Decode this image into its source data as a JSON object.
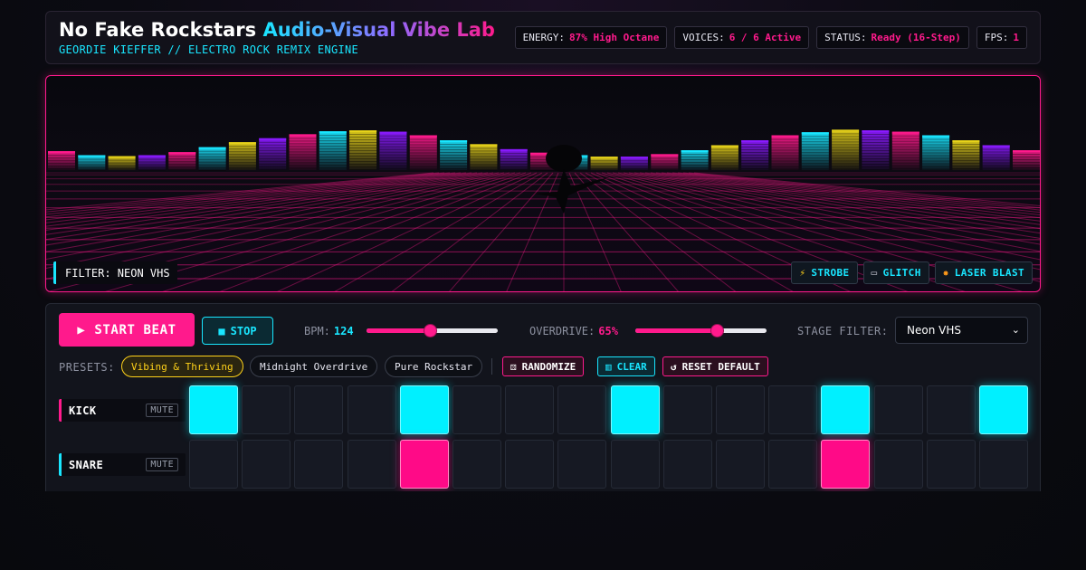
{
  "header": {
    "title_part1": "No Fake Rockstars",
    "title_part2": "Audio-Visual Vibe Lab",
    "subtitle": "GEORDIE KIEFFER // ELECTRO ROCK REMIX ENGINE",
    "stats": [
      {
        "key": "ENERGY:",
        "value": "87% High Octane"
      },
      {
        "key": "VOICES:",
        "value": "6 / 6 Active"
      },
      {
        "key": "STATUS:",
        "value": "Ready (16-Step)"
      },
      {
        "key": "FPS:",
        "value": "1"
      }
    ]
  },
  "stage": {
    "filter_label": "FILTER: NEON VHS",
    "fx_buttons": [
      {
        "label": "STROBE",
        "icon": "lightning-icon"
      },
      {
        "label": "GLITCH",
        "icon": "cassette-icon"
      },
      {
        "label": "LASER BLAST",
        "icon": "explosion-icon"
      }
    ],
    "equalizer_levels": [
      0.38,
      0.3,
      0.28,
      0.3,
      0.36,
      0.46,
      0.56,
      0.64,
      0.72,
      0.78,
      0.8,
      0.77,
      0.7,
      0.6,
      0.52,
      0.42,
      0.35,
      0.3,
      0.27,
      0.27,
      0.32,
      0.4,
      0.5,
      0.6,
      0.7,
      0.76,
      0.81,
      0.8,
      0.77,
      0.7,
      0.6,
      0.5,
      0.4
    ],
    "colors": {
      "pink": "#ff1a8c",
      "cyan": "#19e6ff",
      "yellow": "#e6d21a",
      "purple": "#8a1aff"
    }
  },
  "controls": {
    "start_label": "START BEAT",
    "stop_label": "STOP",
    "bpm_label": "BPM:",
    "bpm_value": "124",
    "bpm_fraction": 0.48,
    "overdrive_label": "OVERDRIVE:",
    "overdrive_value": "65%",
    "overdrive_fraction": 0.62,
    "stage_filter_label": "STAGE FILTER:",
    "stage_filter_value": "Neon VHS"
  },
  "presets": {
    "label": "PRESETS:",
    "items": [
      "Vibing & Thriving",
      "Midnight Overdrive",
      "Pure Rockstar"
    ],
    "active_index": 0,
    "actions": {
      "randomize": "RANDOMIZE",
      "clear": "CLEAR",
      "reset": "RESET DEFAULT"
    }
  },
  "tracks": [
    {
      "name": "KICK",
      "mute_label": "MUTE",
      "color": "cyan",
      "steps": [
        1,
        0,
        0,
        0,
        1,
        0,
        0,
        0,
        1,
        0,
        0,
        0,
        1,
        0,
        0,
        1
      ]
    },
    {
      "name": "SNARE",
      "mute_label": "MUTE",
      "color": "pink",
      "steps": [
        0,
        0,
        0,
        0,
        1,
        0,
        0,
        0,
        0,
        0,
        0,
        0,
        1,
        0,
        0,
        0
      ]
    }
  ]
}
